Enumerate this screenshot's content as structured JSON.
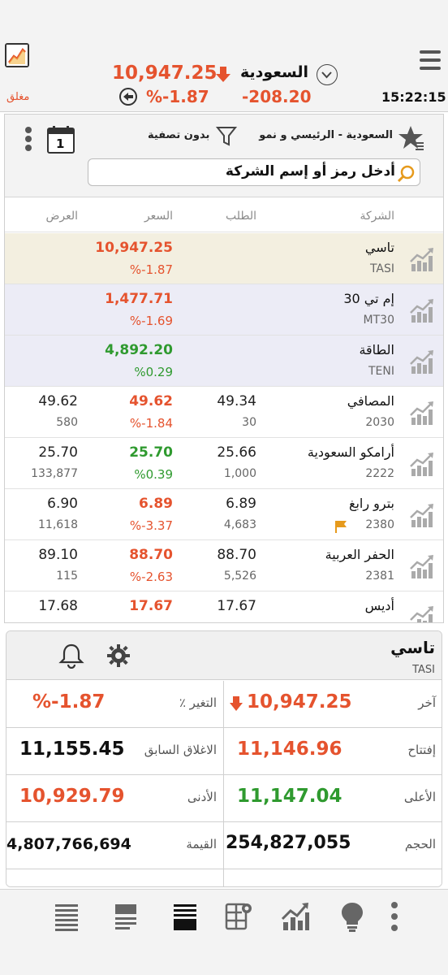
{
  "header": {
    "closed_label": "مغلق",
    "index_price": "10,947.25",
    "market_name": "السعودية",
    "change_pct": "%-1.87",
    "change_value": "-208.20",
    "time": "15:22:15"
  },
  "list": {
    "title": "السعودية - الرئيسي و نمو",
    "filter_label": "بدون تصفية",
    "calendar_value": "1",
    "search_placeholder": "أدخل رمز أو إسم الشركة",
    "columns": {
      "company": "الشركة",
      "bid": "الطلب",
      "price": "السعر",
      "ask": "العرض"
    },
    "rows": [
      {
        "name": "تاسي",
        "code": "TASI",
        "price": "10,947.25",
        "pct": "%-1.87",
        "bid": "",
        "bid_qty": "",
        "ask": "",
        "ask_qty": "",
        "dir": "down",
        "bg": "#f3efe0"
      },
      {
        "name": "إم تي 30",
        "code": "MT30",
        "price": "1,477.71",
        "pct": "%-1.69",
        "bid": "",
        "bid_qty": "",
        "ask": "",
        "ask_qty": "",
        "dir": "down",
        "bg": "#ececf6"
      },
      {
        "name": "الطاقة",
        "code": "TENI",
        "price": "4,892.20",
        "pct": "%0.29",
        "bid": "",
        "bid_qty": "",
        "ask": "",
        "ask_qty": "",
        "dir": "up",
        "bg": "#ececf6"
      },
      {
        "name": "المصافي",
        "code": "2030",
        "price": "49.62",
        "pct": "%-1.84",
        "bid": "49.34",
        "bid_qty": "30",
        "ask": "49.62",
        "ask_qty": "580",
        "dir": "down",
        "bg": "#ffffff"
      },
      {
        "name": "أرامكو السعودية",
        "code": "2222",
        "price": "25.70",
        "pct": "%0.39",
        "bid": "25.66",
        "bid_qty": "1,000",
        "ask": "25.70",
        "ask_qty": "133,877",
        "dir": "up",
        "bg": "#ffffff"
      },
      {
        "name": "بترو رابغ",
        "code": "2380",
        "price": "6.89",
        "pct": "%-3.37",
        "bid": "6.89",
        "bid_qty": "4,683",
        "ask": "6.90",
        "ask_qty": "11,618",
        "dir": "down",
        "bg": "#ffffff",
        "flag": true
      },
      {
        "name": "الحفر العربية",
        "code": "2381",
        "price": "88.70",
        "pct": "%-2.63",
        "bid": "88.70",
        "bid_qty": "5,526",
        "ask": "89.10",
        "ask_qty": "115",
        "dir": "down",
        "bg": "#ffffff"
      },
      {
        "name": "أديس",
        "code": "",
        "price": "17.67",
        "pct": "",
        "bid": "17.67",
        "bid_qty": "",
        "ask": "17.68",
        "ask_qty": "",
        "dir": "down",
        "bg": "#ffffff"
      }
    ]
  },
  "detail": {
    "name": "تاسي",
    "code": "TASI",
    "last_label": "آخر",
    "last_value": "10,947.25",
    "change_label": "التغير ٪",
    "change_value": "%-1.87",
    "open_label": "إفتتاح",
    "open_value": "11,146.96",
    "prev_close_label": "الاغلاق السابق",
    "prev_close_value": "11,155.45",
    "high_label": "الأعلى",
    "high_value": "11,147.04",
    "low_label": "الأدنى",
    "low_value": "10,929.79",
    "volume_label": "الحجم",
    "volume_value": "254,827,055",
    "value_label": "القيمة",
    "value_value": "4,807,766,694"
  },
  "colors": {
    "down": "#e5532e",
    "up": "#2f9a2f",
    "header_bg": "#f3f3f3"
  },
  "nav": {
    "items": [
      "list-lines-icon",
      "document-icon",
      "stacked-list-icon",
      "settings-grid-icon",
      "chart-icon",
      "lightbulb-icon",
      "more-dots-icon"
    ]
  }
}
